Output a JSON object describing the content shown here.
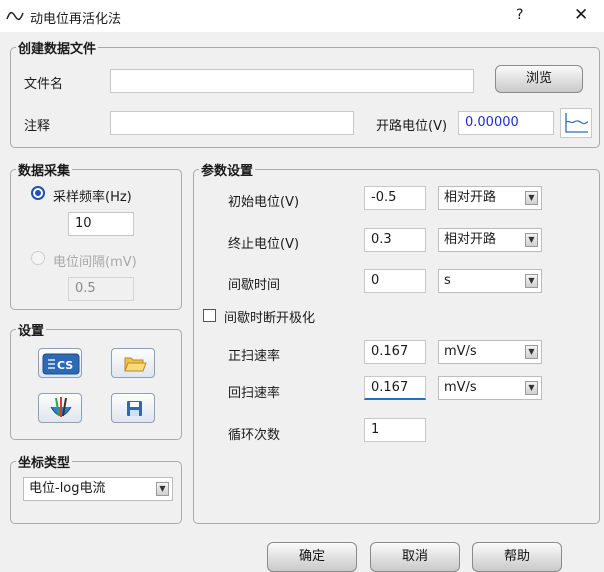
{
  "window": {
    "title": "动电位再活化法",
    "help_glyph": "?",
    "close_glyph": "✕",
    "icon": "waveform-icon"
  },
  "create_file": {
    "legend": "创建数据文件",
    "filename_label": "文件名",
    "filename_value": "",
    "browse_label": "浏览",
    "note_label": "注释",
    "note_value": "",
    "ocp_label": "开路电位(V)",
    "ocp_value": "0.00000",
    "ocp_icon": "ocp-chart-icon"
  },
  "acquisition": {
    "legend": "数据采集",
    "sample_rate_label": "采样频率(Hz)",
    "sample_rate_value": "10",
    "sample_rate_selected": true,
    "potential_interval_label": "电位间隔(mV)",
    "potential_interval_value": "0.5",
    "potential_interval_enabled": false
  },
  "settings": {
    "legend": "设置",
    "buttons": [
      {
        "icon": "cs-instrument-icon"
      },
      {
        "icon": "open-folder-icon"
      },
      {
        "icon": "electrode-cell-icon"
      },
      {
        "icon": "save-floppy-icon"
      }
    ]
  },
  "coordinate": {
    "legend": "坐标类型",
    "selected": "电位-log电流"
  },
  "params": {
    "legend": "参数设置",
    "initial_potential_label": "初始电位(V)",
    "initial_potential_value": "-0.5",
    "initial_potential_ref": "相对开路",
    "final_potential_label": "终止电位(V)",
    "final_potential_value": "0.3",
    "final_potential_ref": "相对开路",
    "pause_time_label": "间歇时间",
    "pause_time_value": "0",
    "pause_time_unit": "s",
    "pause_disconnect_label": "间歇时断开极化",
    "pause_disconnect_checked": false,
    "forward_rate_label": "正扫速率",
    "forward_rate_value": "0.167",
    "forward_rate_unit": "mV/s",
    "reverse_rate_label": "回扫速率",
    "reverse_rate_value": "0.167",
    "reverse_rate_unit": "mV/s",
    "cycles_label": "循环次数",
    "cycles_value": "1"
  },
  "footer": {
    "ok_label": "确定",
    "cancel_label": "取消",
    "help_label": "帮助"
  },
  "colors": {
    "accent": "#1f4fb0",
    "ocp_value_text": "#1b2bd8",
    "focus_underline": "#2b6cb8"
  }
}
